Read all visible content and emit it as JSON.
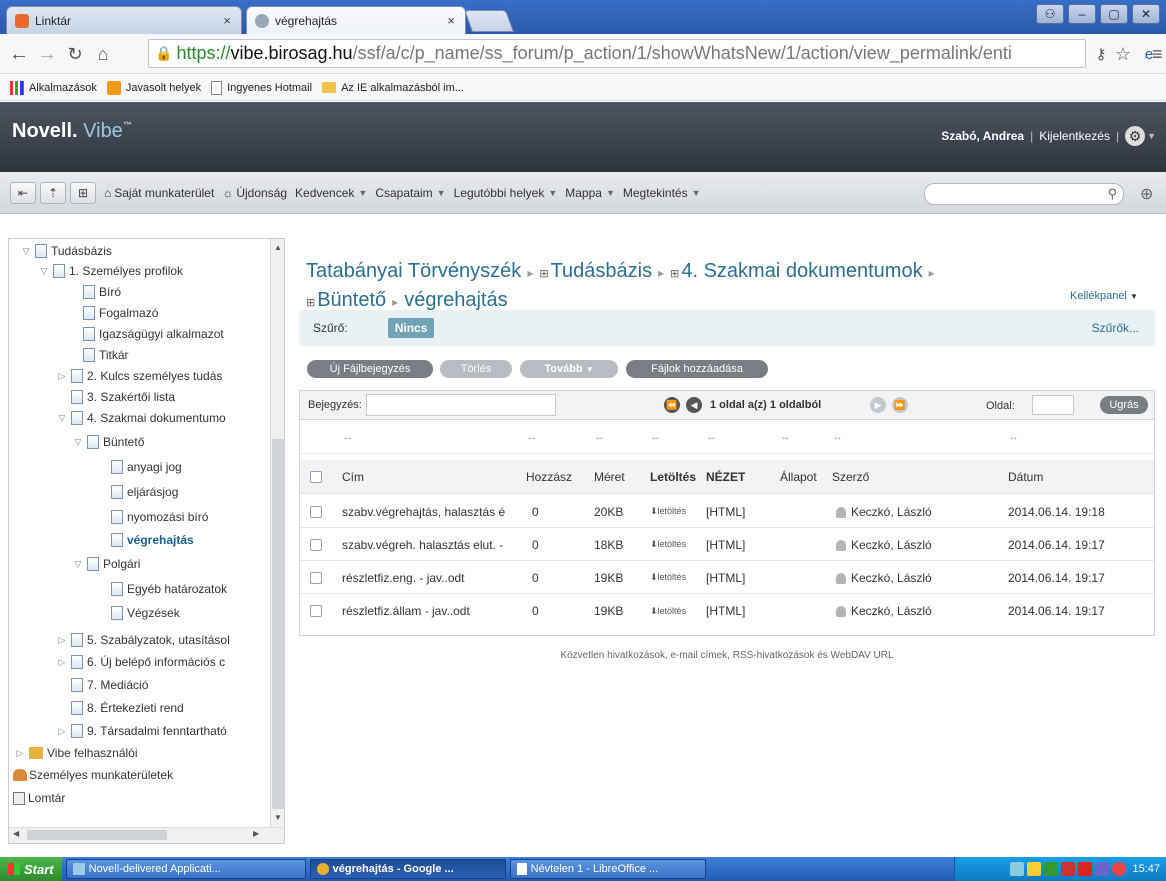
{
  "browser": {
    "tabs": [
      {
        "label": "Linktár"
      },
      {
        "label": "végrehajtás"
      }
    ],
    "address": {
      "scheme": "https://",
      "host": "vibe.birosag.hu",
      "path": "/ssf/a/c/p_name/ss_forum/p_action/1/showWhatsNew/1/action/view_permalink/enti"
    },
    "bookmarks": [
      {
        "label": "Alkalmazások",
        "icon": "apps-icon"
      },
      {
        "label": "Javasolt helyek",
        "icon": "suggested-icon"
      },
      {
        "label": "Ingyenes Hotmail",
        "icon": "page-icon"
      },
      {
        "label": "Az IE alkalmazásból im...",
        "icon": "folder-icon"
      }
    ]
  },
  "header": {
    "logo_main": "Novell.",
    "logo_vibe": "Vibe",
    "logo_tm": "™",
    "user": "Szabó, Andrea",
    "logout": "Kijelentkezés"
  },
  "nav": {
    "items": [
      {
        "label": "Saját munkaterület"
      },
      {
        "label": "Újdonság"
      },
      {
        "label": "Kedvencek"
      },
      {
        "label": "Csapataim"
      },
      {
        "label": "Legutóbbi helyek"
      },
      {
        "label": "Mappa"
      },
      {
        "label": "Megtekintés"
      }
    ]
  },
  "tree": {
    "items": [
      {
        "label": "Tudásbázis"
      },
      {
        "label": "1. Személyes profilok"
      },
      {
        "label": "Bíró"
      },
      {
        "label": "Fogalmazó"
      },
      {
        "label": "Igazságügyi alkalmazot"
      },
      {
        "label": "Titkár"
      },
      {
        "label": "2. Kulcs személyes tudás"
      },
      {
        "label": "3. Szakértői lista"
      },
      {
        "label": "4. Szakmai dokumentumo"
      },
      {
        "label": "Büntető"
      },
      {
        "label": "anyagi jog"
      },
      {
        "label": "eljárásjog"
      },
      {
        "label": "nyomozási bíró"
      },
      {
        "label": "végrehajtás"
      },
      {
        "label": "Polgári"
      },
      {
        "label": "Egyéb határozatok"
      },
      {
        "label": "Végzések"
      },
      {
        "label": "5. Szabályzatok, utasításol"
      },
      {
        "label": "6. Új belépő információs c"
      },
      {
        "label": "7. Mediáció"
      },
      {
        "label": "8. Értekezleti rend"
      },
      {
        "label": "9. Társadalmi fenntartható"
      },
      {
        "label": "Vibe felhasználói"
      },
      {
        "label": "Személyes munkaterületek"
      },
      {
        "label": "Lomtár"
      }
    ]
  },
  "main": {
    "breadcrumb": {
      "b1": "Tatabányai Törvényszék",
      "b2": "Tudásbázis",
      "b3": "4. Szakmai dokumentumok",
      "b4": "Büntető",
      "b5": "végrehajtás"
    },
    "kellekpanel": "Kellékpanel",
    "filter": {
      "label": "Szűrő:",
      "value": "Nincs",
      "link": "Szűrők..."
    },
    "actions": {
      "new_file": "Új Fájlbejegyzés",
      "delete": "Törlés",
      "more": "Tovább",
      "add_files": "Fájlok hozzáadása"
    },
    "pager": {
      "entry_label": "Bejegyzés:",
      "page_info": "1 oldal a(z) 1 oldalból",
      "page_label": "Oldal:",
      "go": "Ugrás"
    },
    "columns": [
      "Cím",
      "Hozzász",
      "Méret",
      "Letöltés",
      "NÉZET",
      "Állapot",
      "Szerző",
      "Dátum"
    ],
    "resize_glyph": "↔",
    "rows": [
      {
        "title": "szabv.végrehajtás, halasztás é",
        "comments": "0",
        "size": "20KB",
        "download": "letöltés",
        "view": "[HTML]",
        "status": "",
        "author": "Keczkó, László",
        "date": "2014.06.14. 19:18"
      },
      {
        "title": "szabv.végreh. halasztás elut. -",
        "comments": "0",
        "size": "18KB",
        "download": "letöltés",
        "view": "[HTML]",
        "status": "",
        "author": "Keczkó, László",
        "date": "2014.06.14. 19:17"
      },
      {
        "title": "részletfiz.eng. - jav..odt",
        "comments": "0",
        "size": "19KB",
        "download": "letöltés",
        "view": "[HTML]",
        "status": "",
        "author": "Keczkó, László",
        "date": "2014.06.14. 19:17"
      },
      {
        "title": "részletfiz.állam - jav..odt",
        "comments": "0",
        "size": "19KB",
        "download": "letöltés",
        "view": "[HTML]",
        "status": "",
        "author": "Keczkó, László",
        "date": "2014.06.14. 19:17"
      }
    ],
    "footer": "Közvetlen hivatkozások, e-mail címek, RSS-hivatkozások és WebDAV URL"
  },
  "taskbar": {
    "start": "Start",
    "tasks": [
      {
        "label": "Novell-delivered Applicati..."
      },
      {
        "label": "végrehajtás - Google ..."
      },
      {
        "label": "Névtelen 1 - LibreOffice ..."
      }
    ],
    "clock": "15:47"
  },
  "colors": {
    "accent": "#2a6f8f",
    "filter_badge": "#6fa3b5",
    "chrome_frame": "#2a58a8"
  }
}
